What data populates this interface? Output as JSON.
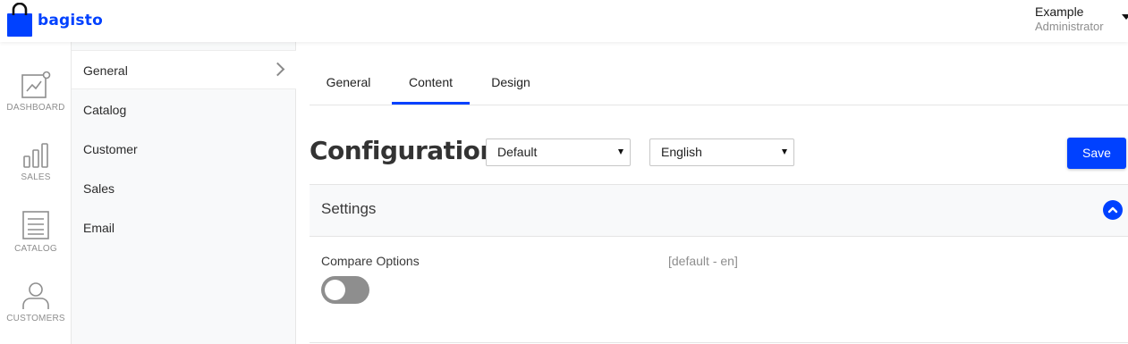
{
  "header": {
    "brand": "bagisto",
    "user_name": "Example",
    "user_role": "Administrator"
  },
  "nav": {
    "items": [
      {
        "label": "DASHBOARD",
        "icon": "dashboard-icon"
      },
      {
        "label": "SALES",
        "icon": "sales-icon"
      },
      {
        "label": "CATALOG",
        "icon": "catalog-icon"
      },
      {
        "label": "CUSTOMERS",
        "icon": "customers-icon"
      }
    ]
  },
  "subnav": {
    "items": [
      {
        "label": "General",
        "active": true
      },
      {
        "label": "Catalog"
      },
      {
        "label": "Customer"
      },
      {
        "label": "Sales"
      },
      {
        "label": "Email"
      }
    ]
  },
  "tabs": [
    {
      "label": "General"
    },
    {
      "label": "Content",
      "active": true
    },
    {
      "label": "Design"
    }
  ],
  "main": {
    "title": "Configuration",
    "channel_select": "Default",
    "locale_select": "English",
    "save_label": "Save"
  },
  "panel": {
    "title": "Settings",
    "field_label": "Compare Options",
    "field_scope": "[default - en]",
    "toggle_on": false
  },
  "colors": {
    "accent": "#0041ff",
    "toggle_off": "#8e8e8e"
  }
}
